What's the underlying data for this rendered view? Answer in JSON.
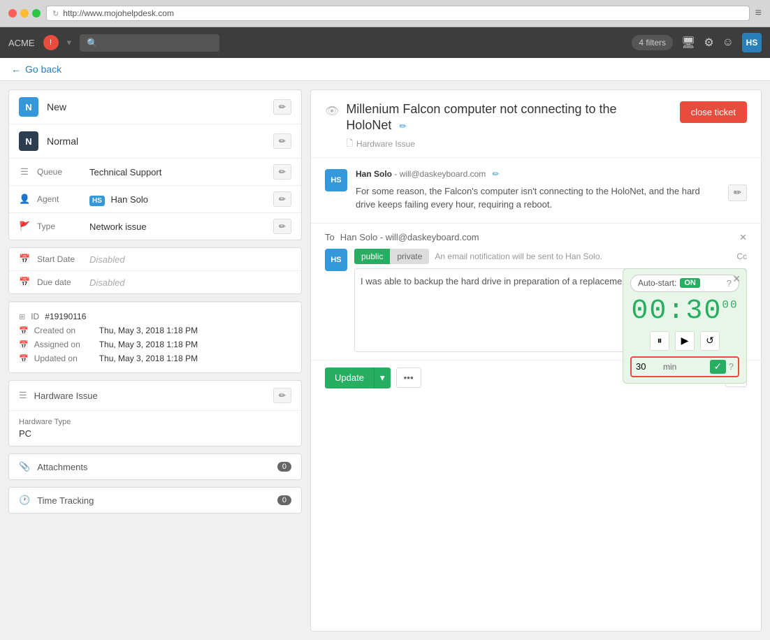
{
  "browser": {
    "url": "http://www.mojohelpdesk.com",
    "menu_icon": "≡"
  },
  "header": {
    "app_name": "ACME",
    "notification_icon": "!",
    "filters_label": "4 filters",
    "avatar_label": "HS"
  },
  "go_back": {
    "label": "Go back"
  },
  "sidebar": {
    "status": {
      "new_label": "New",
      "new_badge": "N",
      "priority_label": "Normal",
      "priority_badge": "N"
    },
    "fields": {
      "queue_label": "Queue",
      "queue_value": "Technical Support",
      "agent_label": "Agent",
      "agent_badge": "HS",
      "agent_value": "Han Solo",
      "type_label": "Type",
      "type_value": "Network issue"
    },
    "dates": {
      "start_label": "Start Date",
      "start_value": "Disabled",
      "due_label": "Due date",
      "due_value": "Disabled"
    },
    "meta": {
      "id_label": "ID",
      "id_value": "#19190116",
      "created_label": "Created on",
      "created_value": "Thu, May 3, 2018 1:18 PM",
      "assigned_label": "Assigned on",
      "assigned_value": "Thu, May 3, 2018 1:18 PM",
      "updated_label": "Updated on",
      "updated_value": "Thu, May 3, 2018 1:18 PM"
    },
    "category": {
      "label": "Hardware Issue"
    },
    "hw_type": {
      "label": "Hardware Type",
      "value": "PC"
    },
    "attachments": {
      "label": "Attachments",
      "count": "0"
    },
    "time_tracking": {
      "label": "Time Tracking",
      "count": "0"
    }
  },
  "ticket": {
    "title": "Millenium Falcon computer not connecting to the HoloNet",
    "category": "Hardware Issue",
    "close_btn": "close ticket",
    "author": "Han Solo",
    "author_email": "will@daskeyboard.com",
    "message": "For some reason, the Falcon's computer isn't connecting to the HoloNet, and the hard drive keeps failing every hour, requiring a reboot."
  },
  "compose": {
    "to_label": "To",
    "to_value": "Han Solo - will@daskeyboard.com",
    "tab_public": "public",
    "tab_private": "private",
    "cc_hint": "An email notification will be sent to Han Solo.",
    "cc_label": "Cc",
    "reply_text": "I was able to backup the hard drive in preparation of a replacement.",
    "markdown_preview": "markdown preview",
    "update_btn": "Update"
  },
  "timer": {
    "auto_start_label": "Auto-start:",
    "toggle_label": "ON",
    "time_display": "00:30",
    "time_cents": "00",
    "input_value": "30",
    "input_unit": "min"
  }
}
